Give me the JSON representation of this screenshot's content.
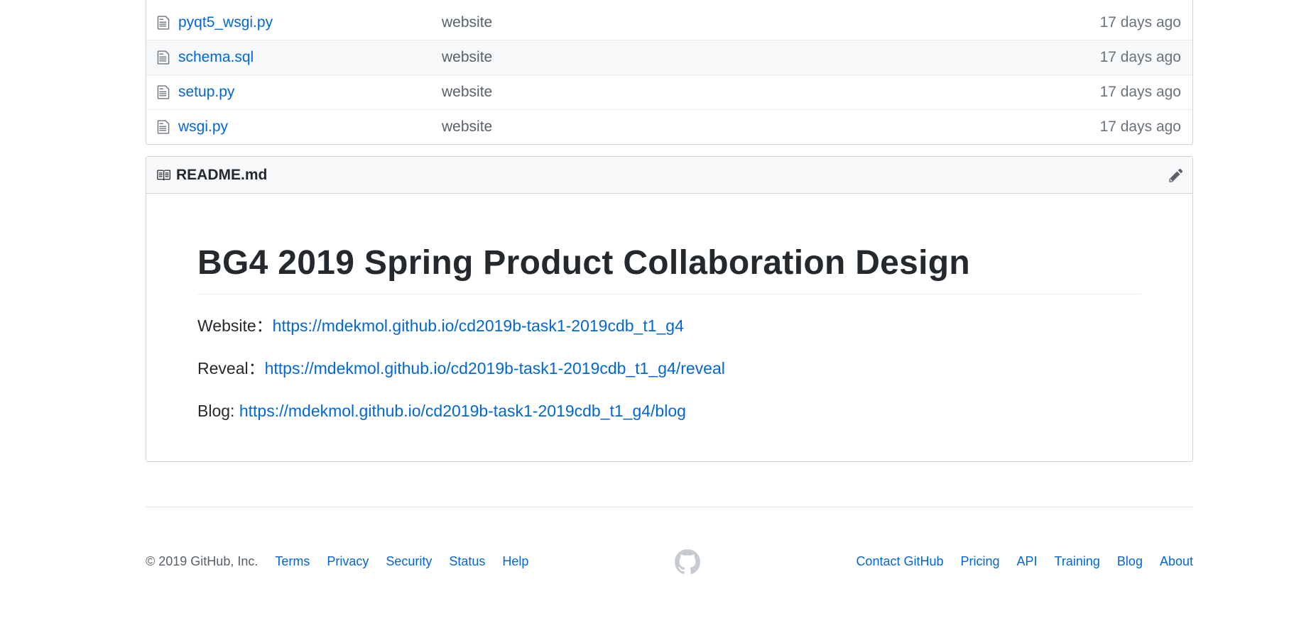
{
  "files": [
    {
      "name": "pyqt5_wsgi.py",
      "message": "website",
      "age": "17 days ago"
    },
    {
      "name": "schema.sql",
      "message": "website",
      "age": "17 days ago"
    },
    {
      "name": "setup.py",
      "message": "website",
      "age": "17 days ago"
    },
    {
      "name": "wsgi.py",
      "message": "website",
      "age": "17 days ago"
    }
  ],
  "readme": {
    "filename": "README.md",
    "heading": "BG4 2019 Spring Product Collaboration Design",
    "lines": [
      {
        "label": "Website：",
        "link": "https://mdekmol.github.io/cd2019b-task1-2019cdb_t1_g4"
      },
      {
        "label": "Reveal：",
        "link": "https://mdekmol.github.io/cd2019b-task1-2019cdb_t1_g4/reveal"
      },
      {
        "label": "Blog: ",
        "link": "https://mdekmol.github.io/cd2019b-task1-2019cdb_t1_g4/blog"
      }
    ]
  },
  "footer": {
    "copyright": "© 2019 GitHub, Inc.",
    "left_links": [
      "Terms",
      "Privacy",
      "Security",
      "Status",
      "Help"
    ],
    "right_links": [
      "Contact GitHub",
      "Pricing",
      "API",
      "Training",
      "Blog",
      "About"
    ]
  },
  "icons": {
    "file": "file-icon",
    "readme": "book-icon",
    "edit": "pencil-icon",
    "logo": "github-logo-icon"
  },
  "colors": {
    "link": "#0366d6",
    "muted": "#586069",
    "border": "#d1d5da",
    "header_bg": "#f6f8fa"
  }
}
